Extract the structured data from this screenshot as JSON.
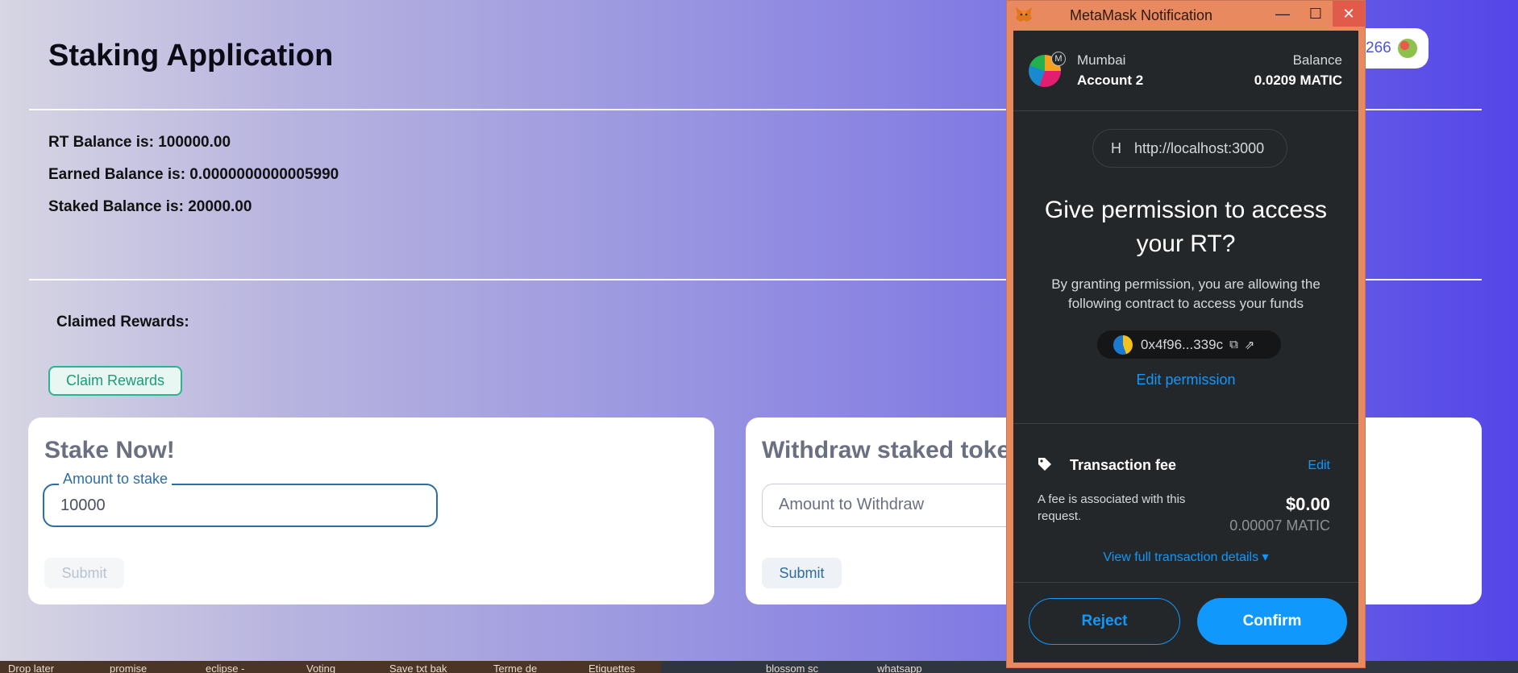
{
  "app": {
    "title": "Staking Application",
    "account_suffix": "266",
    "rt_balance": "RT Balance is: 100000.00",
    "earned_balance": "Earned Balance is: 0.0000000000005990",
    "staked_balance": "Staked Balance is: 20000.00",
    "claimed_rewards": "Claimed Rewards:",
    "claim_button": "Claim Rewards",
    "stake_card": {
      "title": "Stake Now!",
      "field_label": "Amount to stake",
      "field_value": "10000",
      "submit": "Submit"
    },
    "withdraw_card": {
      "title": "Withdraw staked toke",
      "field_placeholder": "Amount to Withdraw",
      "submit": "Submit"
    }
  },
  "metamask": {
    "window_title": "MetaMask Notification",
    "window_controls": {
      "minimize": "—",
      "maximize": "☐",
      "close": "✕"
    },
    "network": "Mumbai",
    "network_badge": "M",
    "account": "Account 2",
    "balance_label": "Balance",
    "balance_value": "0.0209 MATIC",
    "origin_initial": "H",
    "origin": "http://localhost:3000",
    "permission_title": "Give permission to access your RT?",
    "permission_desc": "By granting permission, you are allowing the following contract to access your funds",
    "contract_address": "0x4f96...339c",
    "edit_permission": "Edit permission",
    "fee_title": "Transaction fee",
    "fee_edit": "Edit",
    "fee_desc": "A fee is associated with this request.",
    "fee_usd": "$0.00",
    "fee_matic": "0.00007 MATIC",
    "view_details": "View full transaction details ▾",
    "reject": "Reject",
    "confirm": "Confirm"
  },
  "taskbar": {
    "items": [
      "Drop later",
      "promise",
      "eclipse -",
      "Voting",
      "Save txt bak",
      "Terme de",
      "Etiquettes",
      "blossom sc",
      "whatsapp"
    ]
  }
}
